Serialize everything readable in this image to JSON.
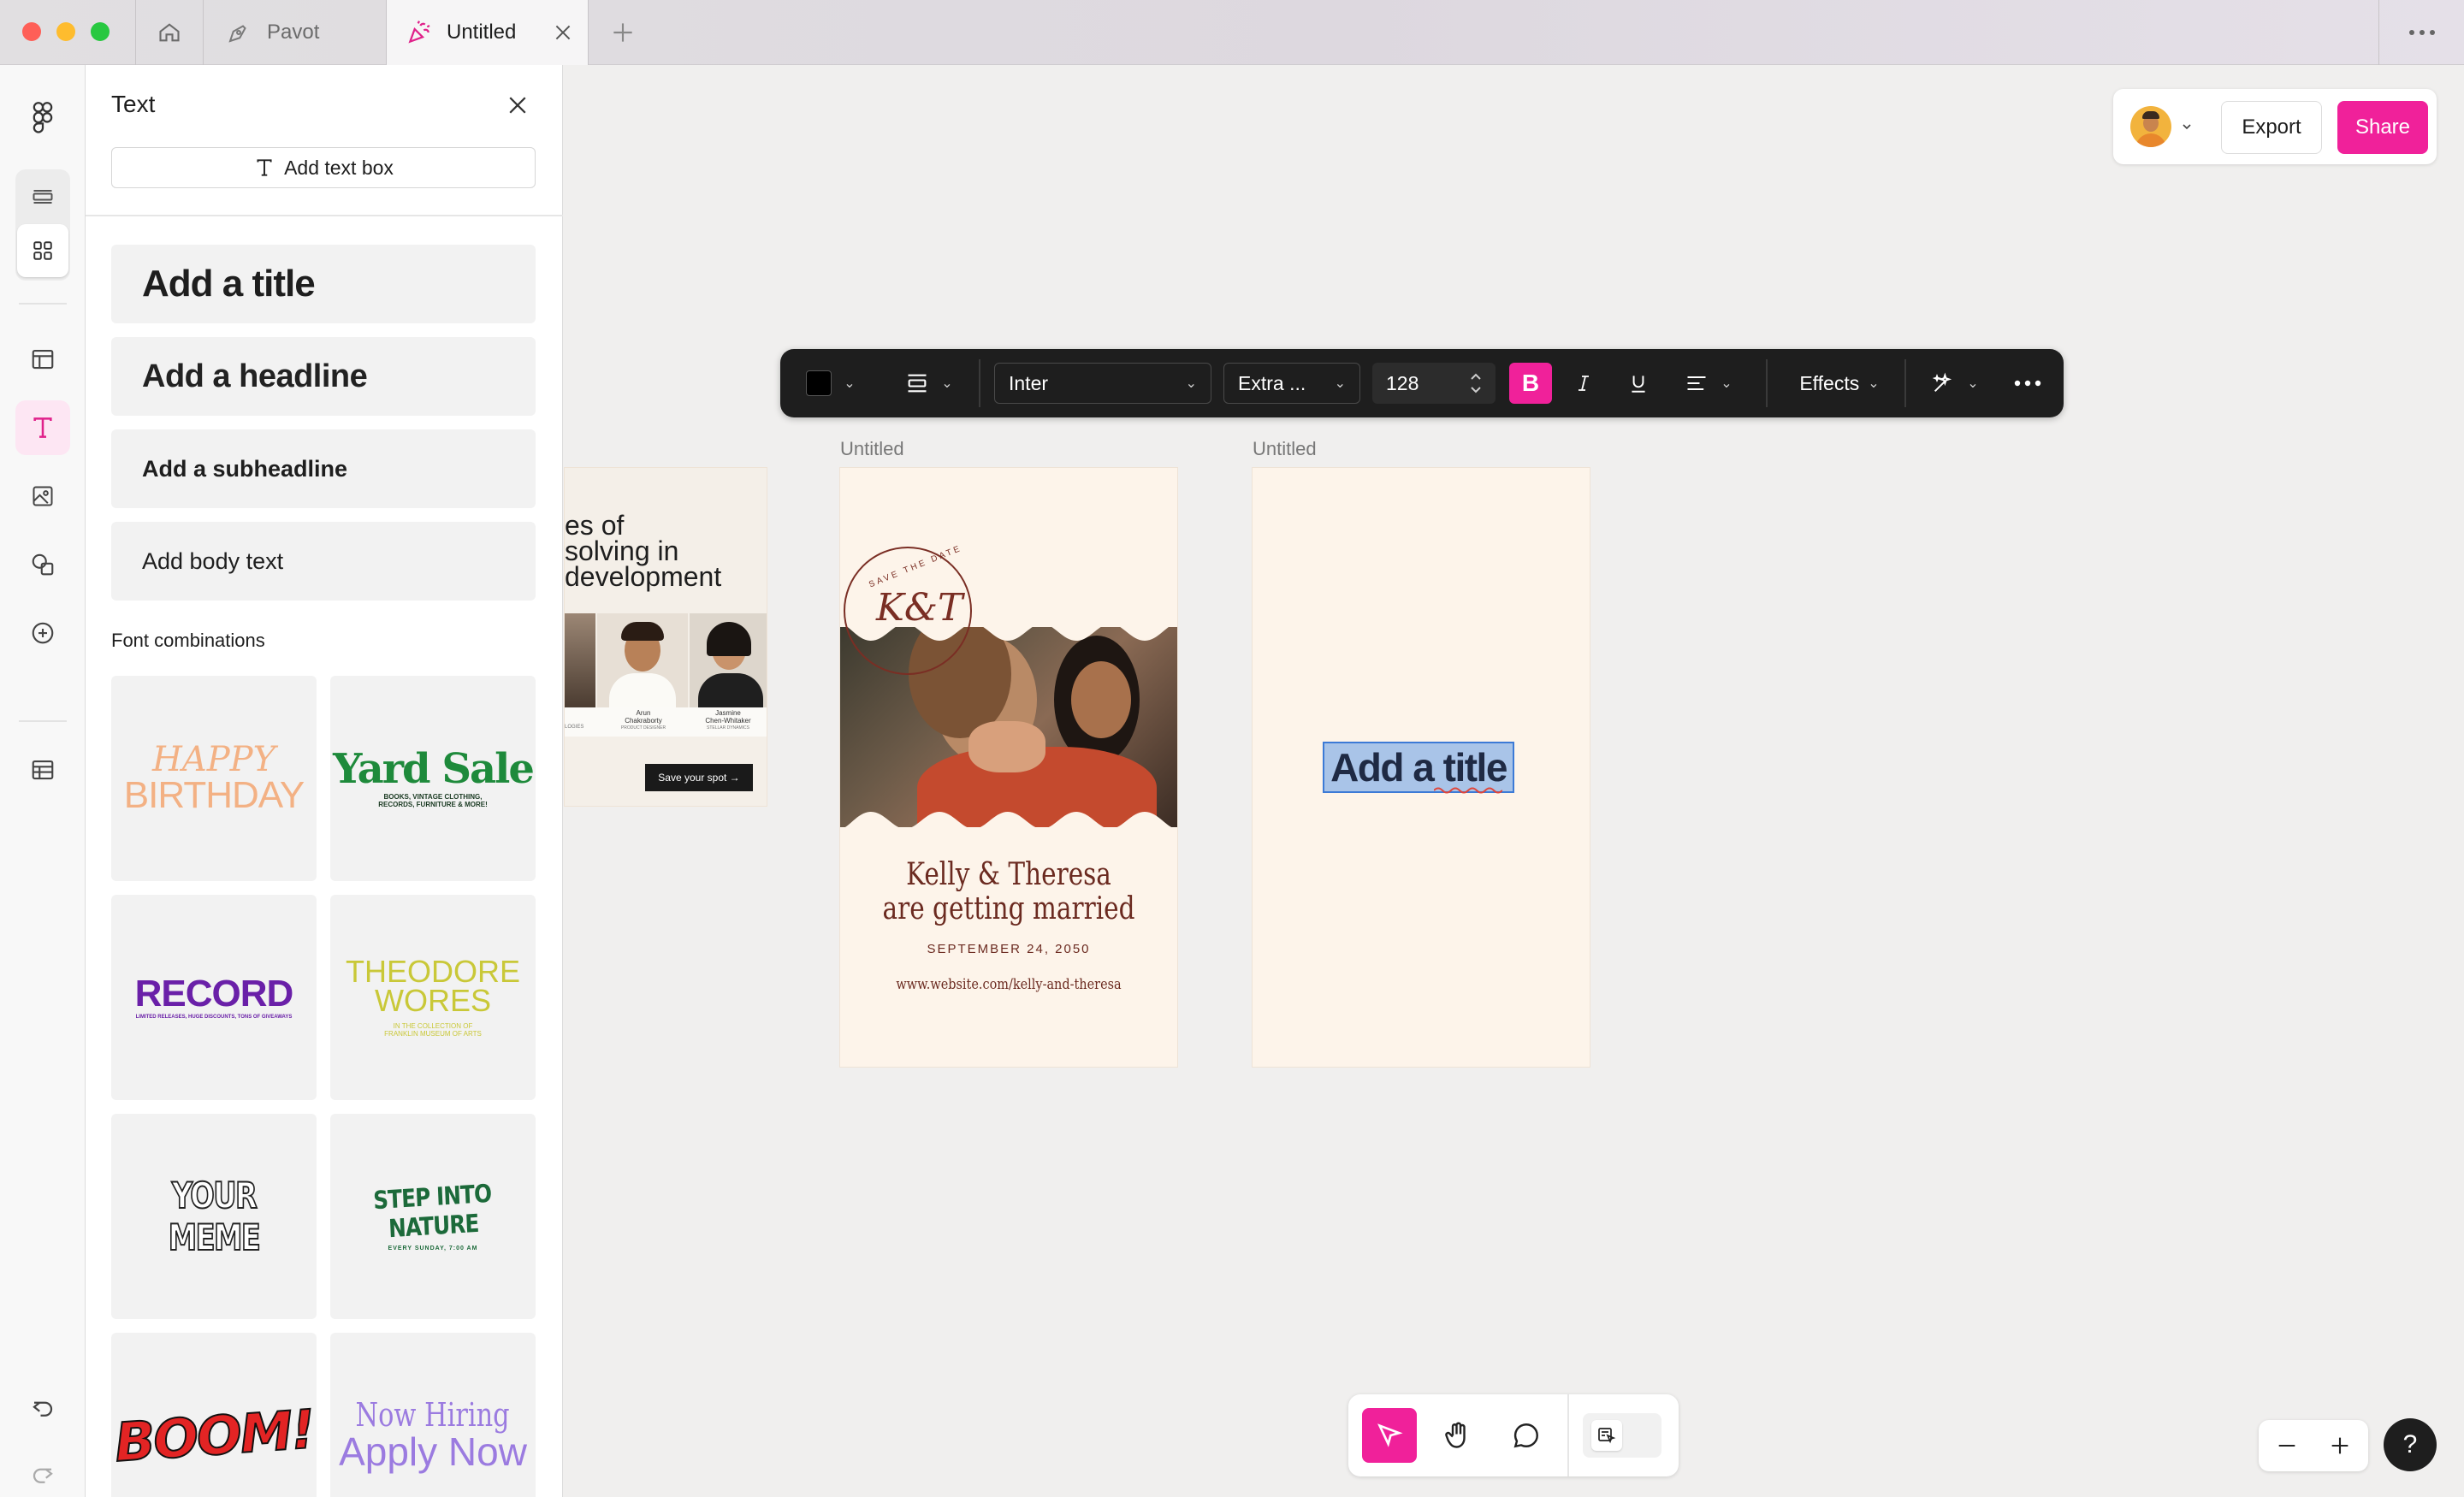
{
  "window": {
    "tabs": [
      {
        "label": "Pavot"
      },
      {
        "label": "Untitled"
      }
    ]
  },
  "panel": {
    "title": "Text",
    "add_text_box": "Add text box",
    "presets": {
      "title": "Add a title",
      "headline": "Add a headline",
      "subheadline": "Add a subheadline",
      "body": "Add body text"
    },
    "font_combinations_label": "Font combinations",
    "combos": {
      "happy_1": "HAPPY",
      "happy_2": "BIRTHDAY",
      "yard_1": "Yard Sale",
      "yard_2": "BOOKS, VINTAGE CLOTHING, RECORDS, FURNITURE & MORE!",
      "record_1": "RECORD",
      "record_2": "LIMITED RELEASES, HUGE DISCOUNTS, TONS OF GIVEAWAYS",
      "theo_1": "THEODORE",
      "theo_2": "WORES",
      "theo_3": "IN THE COLLECTION OF",
      "theo_4": "FRANKLIN MUSEUM OF ARTS",
      "meme": "YOUR MEME",
      "nature_1": "STEP INTO NATURE",
      "nature_2": "EVERY SUNDAY, 7:00 AM",
      "boom": "BOOM!",
      "hiring_1": "Now Hiring",
      "hiring_2": "Apply Now"
    }
  },
  "header": {
    "export_label": "Export",
    "share_label": "Share"
  },
  "toolbar": {
    "font_family": "Inter",
    "font_weight": "Extra ...",
    "font_size": "128",
    "bold_label": "B",
    "effects_label": "Effects"
  },
  "canvas": {
    "partial_card": {
      "line1": "es of",
      "line2": "solving in",
      "line3": "development",
      "person1_first": "Arun",
      "person1_last": "Chakraborty",
      "person1_role": "PRODUCT DESIGNER",
      "person2_first": "Jasmine",
      "person2_last": "Chen-Whitaker",
      "person2_role": "STELLAR DYNAMICS",
      "left_role": "LOGIES",
      "cta": "Save your spot →"
    },
    "card1": {
      "label": "Untitled",
      "badge_top": "SAVE THE DATE",
      "monogram": "K&T",
      "names_line1": "Kelly & Theresa",
      "names_line2": "are getting married",
      "date": "SEPTEMBER 24, 2050",
      "url": "www.website.com/kelly-and-theresa"
    },
    "card2": {
      "label": "Untitled",
      "selected_text": "Add a title"
    }
  },
  "colors": {
    "accent": "#f0219a",
    "toolbar_bg": "#1e1e1e",
    "card_bg": "#fdf4ea",
    "wedding_text": "#6b2a20"
  }
}
